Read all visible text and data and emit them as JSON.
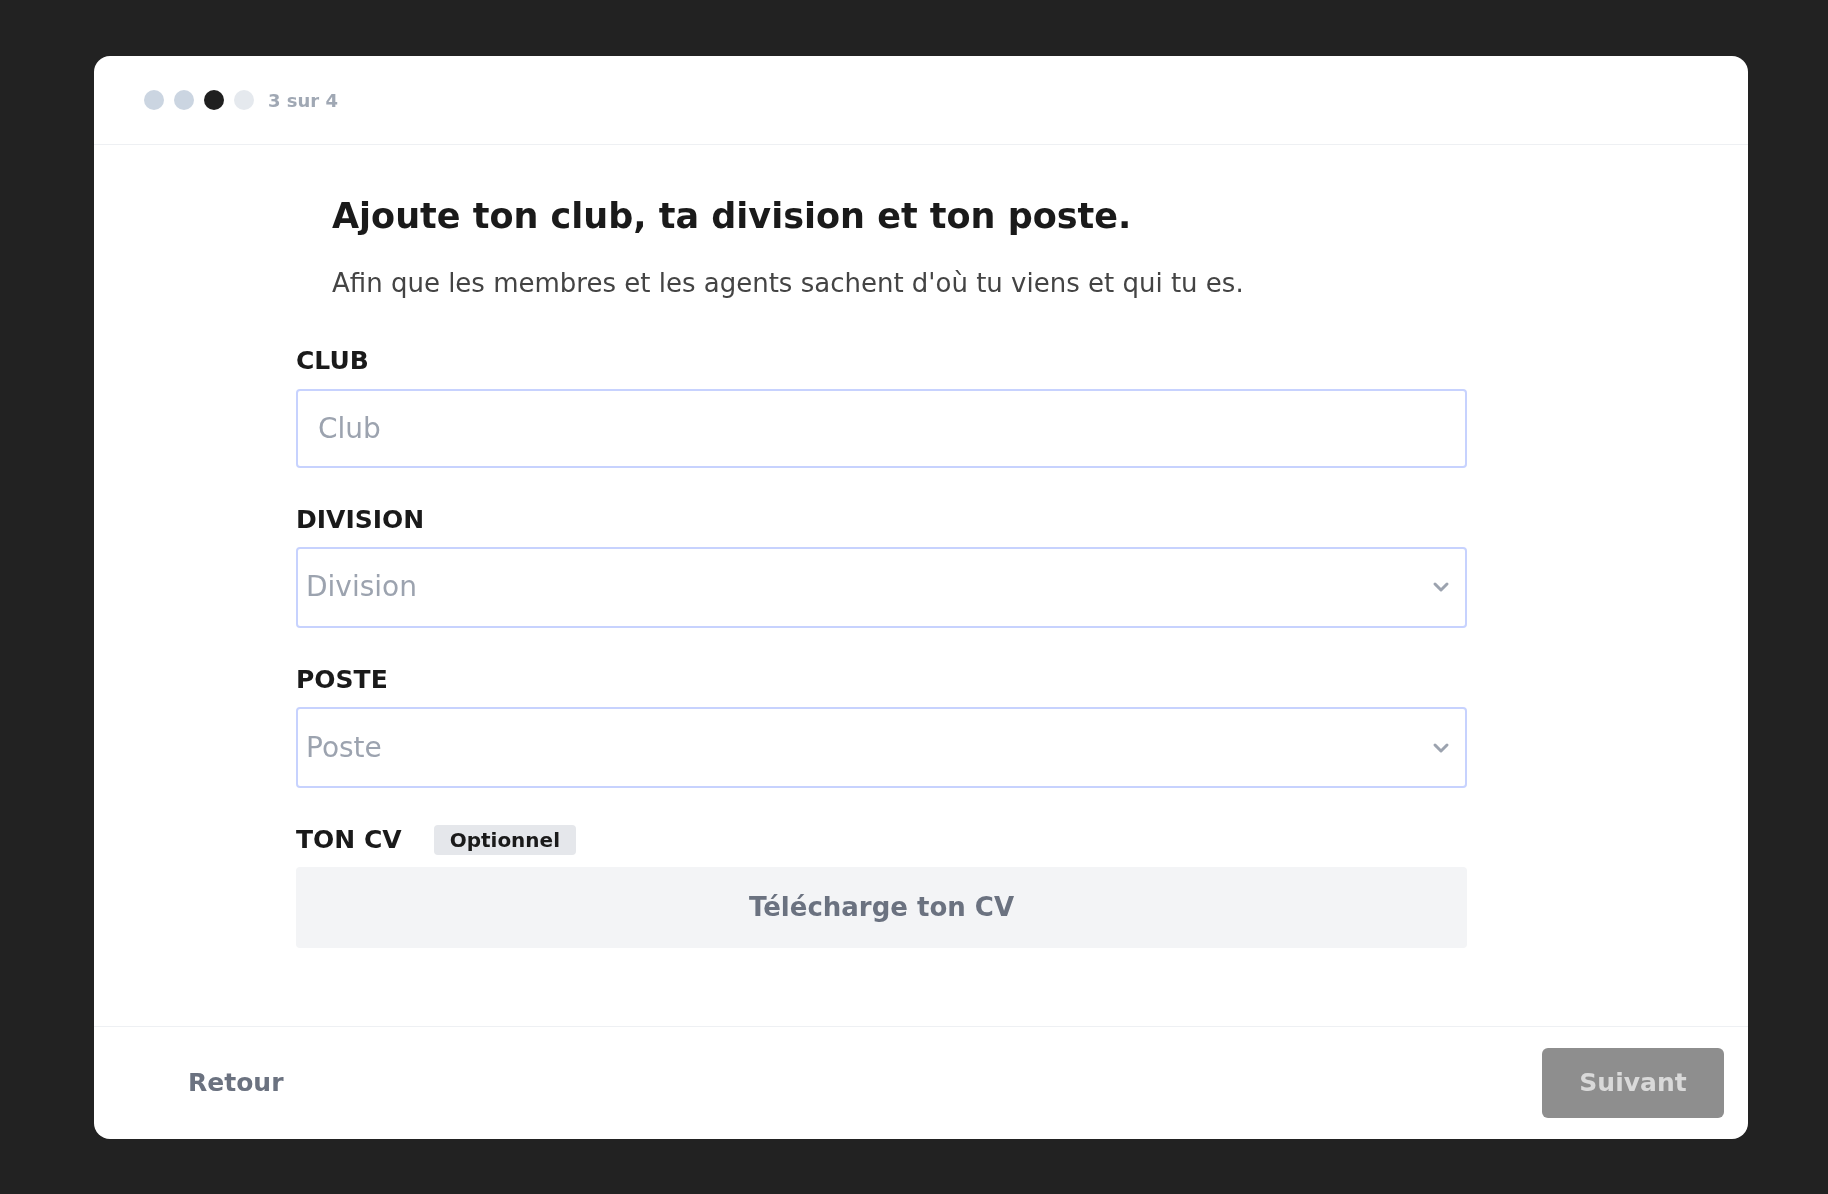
{
  "progress": {
    "steps": [
      {
        "kind": "done"
      },
      {
        "kind": "done"
      },
      {
        "kind": "current"
      },
      {
        "kind": "todo"
      }
    ],
    "label": "3 sur 4"
  },
  "heading": "Ajoute ton club, ta division et ton poste.",
  "subtitle": "Afin que les membres et les agents sachent d'où tu viens et qui tu es.",
  "fields": [
    {
      "kind": "text",
      "label": "CLUB",
      "placeholder": "Club"
    },
    {
      "kind": "select",
      "label": "DIVISION",
      "placeholder": "Division"
    },
    {
      "kind": "select",
      "label": "POSTE",
      "placeholder": "Poste"
    },
    {
      "kind": "upload",
      "label": "TON CV",
      "badge": "Optionnel",
      "button": "Télécharge ton CV"
    }
  ],
  "footer": {
    "back": "Retour",
    "next": {
      "label": "Suivant",
      "disabled": true
    }
  }
}
